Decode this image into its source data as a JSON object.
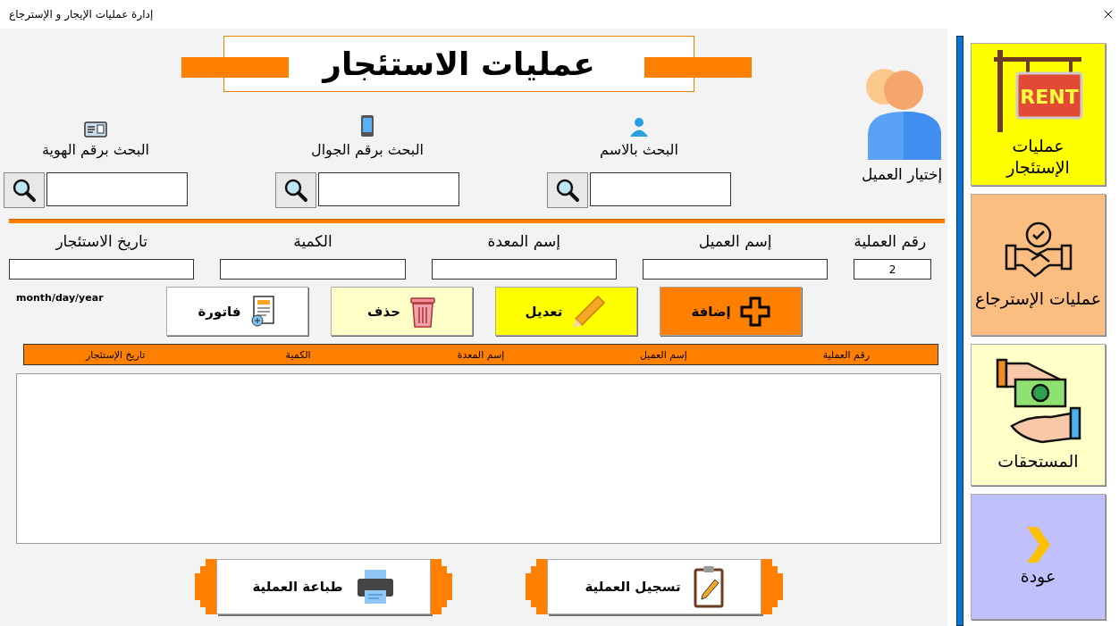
{
  "window": {
    "title": "إدارة عمليات الإيجار و الإسترجاع"
  },
  "header": {
    "title": "عمليات الاستئجار"
  },
  "customer_picker": {
    "label": "إختيار العميل"
  },
  "searches": [
    {
      "kind": "name",
      "label": "البحث بالاسم"
    },
    {
      "kind": "mobile",
      "label": "البحث برقم الجوال"
    },
    {
      "kind": "id",
      "label": "البحث برقم الهوية"
    }
  ],
  "form": {
    "fields": [
      {
        "kind": "number",
        "label": "رقم العملية",
        "value": "2"
      },
      {
        "kind": "text",
        "label": "إسم العميل"
      },
      {
        "kind": "text",
        "label": "إسم المعدة"
      },
      {
        "kind": "text",
        "label": "الكمية"
      },
      {
        "kind": "text",
        "label": "تاريخ الاستئجار"
      }
    ],
    "date_hint": "month/day/year"
  },
  "actions": [
    {
      "kind": "add",
      "label": "إضافة",
      "color": "#ff8000"
    },
    {
      "kind": "edit",
      "label": "تعديل",
      "color": "#ffff00"
    },
    {
      "kind": "delete",
      "label": "حذف",
      "color": "#ffffc8"
    },
    {
      "kind": "invoice",
      "label": "فاتورة",
      "color": "#ffffff"
    }
  ],
  "table": {
    "columns": [
      "رقم العملية",
      "إسم العميل",
      "إسم المعدة",
      "الكمية",
      "تاريخ الإستئجار"
    ]
  },
  "footer_buttons": [
    {
      "kind": "save",
      "label": "تسجيل العملية"
    },
    {
      "kind": "print",
      "label": "طباعة العملية"
    }
  ],
  "sidebar": {
    "items": [
      {
        "kind": "rent",
        "label": "عمليات الإستئجار",
        "sign_text": "RENT",
        "color": "#ffff00"
      },
      {
        "kind": "return",
        "label": "عمليات الإسترجاع",
        "color": "#fbbd80"
      },
      {
        "kind": "dues",
        "label": "المستحقات",
        "color": "#ffffc8"
      },
      {
        "kind": "back",
        "label": "عودة",
        "color": "#c0c0ff"
      }
    ]
  }
}
